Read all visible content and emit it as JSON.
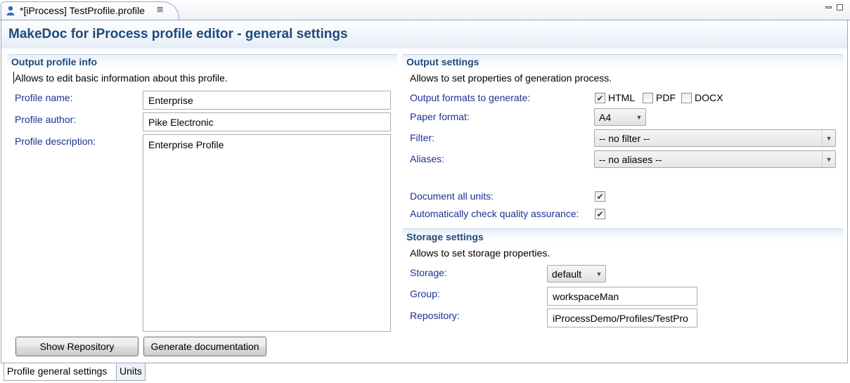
{
  "editor_tab": {
    "title": "*[iProcess] TestProfile.profile",
    "close_glyph": "⊠"
  },
  "window_controls": {
    "minimize_icon": "minimize-icon",
    "maximize_icon": "maximize-icon"
  },
  "page": {
    "title": "MakeDoc for iProcess profile editor - general settings"
  },
  "profile_info": {
    "title": "Output profile info",
    "description": "Allows to edit basic information about this profile.",
    "name_label": "Profile name:",
    "name_value": "Enterprise",
    "author_label": "Profile author:",
    "author_value": "Pike Electronic",
    "description_label": "Profile description:",
    "description_value": "Enterprise Profile"
  },
  "output_settings": {
    "title": "Output settings",
    "description": "Allows to set properties of generation process.",
    "formats_label": "Output formats to generate:",
    "formats": [
      {
        "label": "HTML",
        "checked": true
      },
      {
        "label": "PDF",
        "checked": false
      },
      {
        "label": "DOCX",
        "checked": false
      }
    ],
    "paper_label": "Paper format:",
    "paper_value": "A4",
    "filter_label": "Filter:",
    "filter_value": "-- no filter --",
    "aliases_label": "Aliases:",
    "aliases_value": "-- no aliases --",
    "document_all_label": "Document all units:",
    "document_all_checked": true,
    "qa_label": "Automatically check quality assurance:",
    "qa_checked": true
  },
  "storage_settings": {
    "title": "Storage settings",
    "description": "Allows to set storage properties.",
    "storage_label": "Storage:",
    "storage_value": "default",
    "group_label": "Group:",
    "group_value": "workspaceMan",
    "repository_label": "Repository:",
    "repository_value": "iProcessDemo/Profiles/TestPro"
  },
  "buttons": {
    "show_repository": "Show Repository",
    "generate_documentation": "Generate documentation"
  },
  "page_tabs": [
    {
      "label": "Profile general settings",
      "active": true
    },
    {
      "label": "Units",
      "active": false
    }
  ],
  "colors": {
    "title_blue": "#1f4a7a",
    "label_blue": "#1a3392",
    "border": "#9aa9bf"
  }
}
